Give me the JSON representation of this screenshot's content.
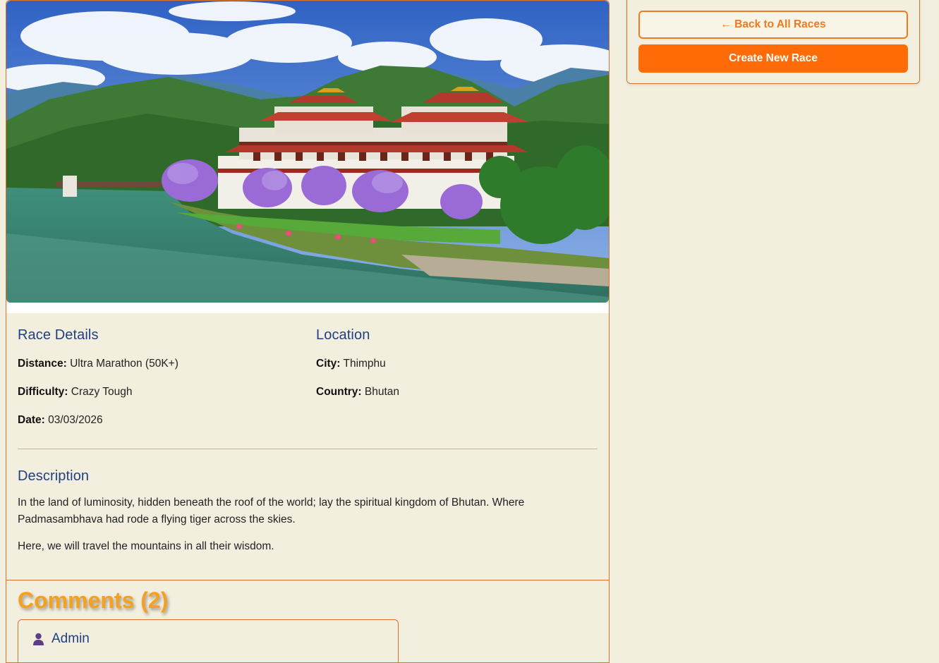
{
  "sidebar": {
    "back_label": "← Back to All Races",
    "create_label": "Create New Race"
  },
  "race_details": {
    "heading": "Race Details",
    "distance_label": "Distance:",
    "distance_value": "Ultra Marathon (50K+)",
    "difficulty_label": "Difficulty:",
    "difficulty_value": "Crazy Tough",
    "date_label": "Date:",
    "date_value": "03/03/2026"
  },
  "location": {
    "heading": "Location",
    "city_label": "City:",
    "city_value": "Thimphu",
    "country_label": "Country:",
    "country_value": "Bhutan"
  },
  "description": {
    "heading": "Description",
    "paragraphs": [
      "In the land of luminosity, hidden beneath the roof of the world; lay the spiritual kingdom of Bhutan. Where Padmasambhava had rode a flying tiger across the skies.",
      "Here, we will travel the mountains in all their wisdom."
    ]
  },
  "comments": {
    "title": "Comments (2)",
    "items": [
      {
        "author": "Admin"
      }
    ]
  },
  "colors": {
    "accent": "#ff6b06",
    "heading_blue": "#1f3f86",
    "comments_orange": "#f5a020",
    "background": "#f3efdf"
  },
  "icons": {
    "user": "user-icon"
  }
}
